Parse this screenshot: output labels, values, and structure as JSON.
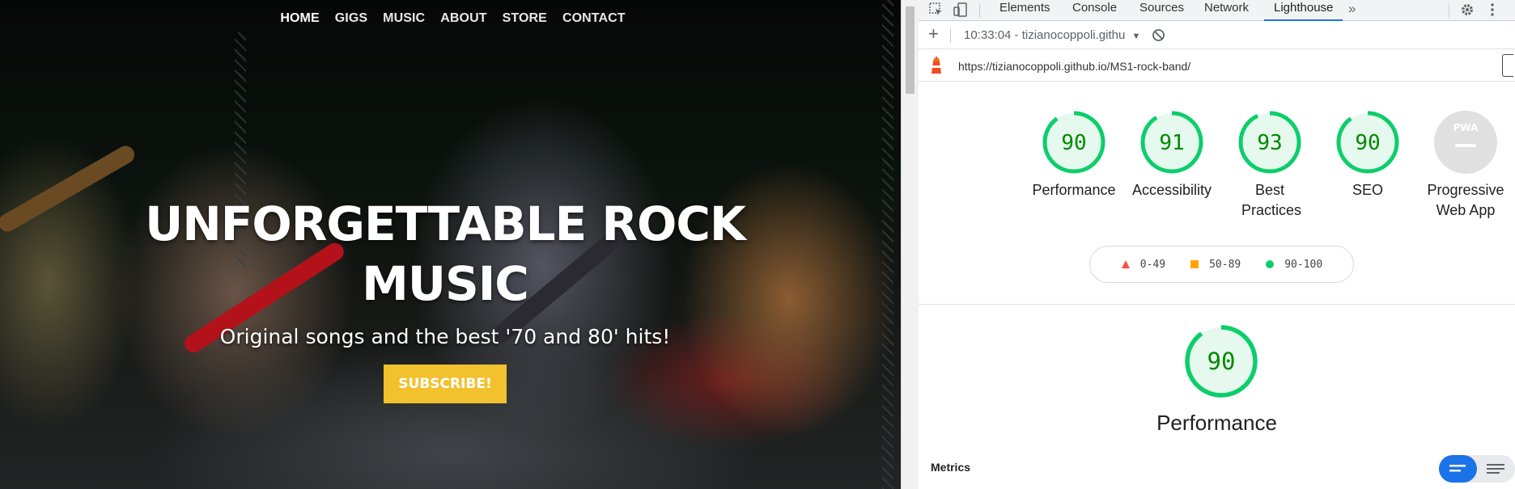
{
  "site": {
    "nav": [
      "HOME",
      "GIGS",
      "MUSIC",
      "ABOUT",
      "STORE",
      "CONTACT"
    ],
    "active_nav": "HOME",
    "hero_title": "UNFORGETTABLE ROCK MUSIC",
    "hero_subtitle": "Original songs and the best '70 and 80' hits!",
    "cta_label": "SUBSCRIBE!",
    "cta_color": "#f2c12e"
  },
  "devtools": {
    "tabs": [
      "Elements",
      "Console",
      "Sources",
      "Network",
      "Lighthouse"
    ],
    "active_tab": "Lighthouse",
    "report_selector": "10:33:04 - tizianocoppoli.githu",
    "url": "https://tizianocoppoli.github.io/MS1-rock-band/",
    "scores": [
      {
        "label": "Performance",
        "value": "90",
        "score": 90
      },
      {
        "label": "Accessibility",
        "value": "91",
        "score": 91
      },
      {
        "label": "Best Practices",
        "value": "93",
        "score": 93
      },
      {
        "label": "SEO",
        "value": "90",
        "score": 90
      }
    ],
    "pwa_label": "Progressive Web App",
    "pwa_badge": "PWA",
    "legend": [
      {
        "range": "0-49",
        "shape": "triangle",
        "color": "#ff4e42"
      },
      {
        "range": "50-89",
        "shape": "square",
        "color": "#ffa400"
      },
      {
        "range": "90-100",
        "shape": "circle",
        "color": "#0cce6b"
      }
    ],
    "performance_score": "90",
    "performance_value": 90,
    "performance_title": "Performance",
    "metrics_label": "Metrics",
    "colors": {
      "pass": "#0cce6b",
      "pass_text": "#008800",
      "pass_bg": "#e6f9ee",
      "accent": "#1a73e8"
    }
  }
}
